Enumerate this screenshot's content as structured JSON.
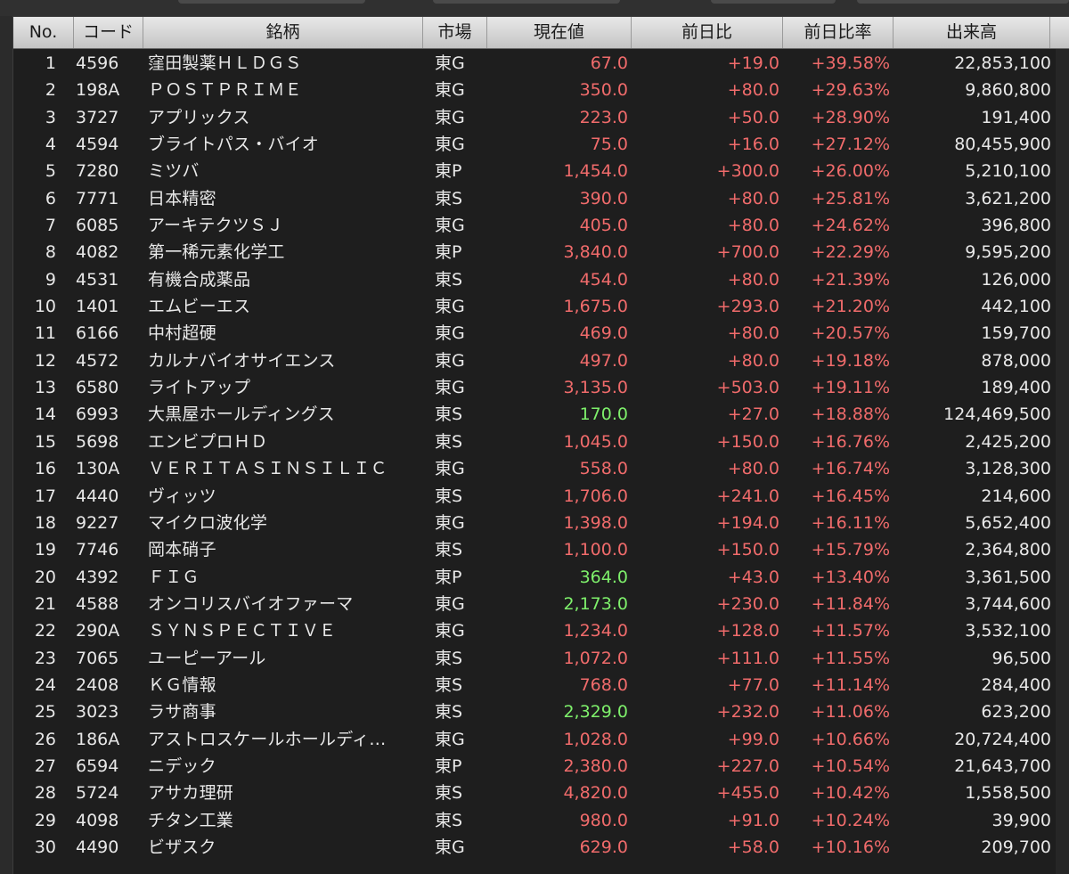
{
  "columns": {
    "no": "No.",
    "code": "コード",
    "name": "銘柄",
    "market": "市場",
    "price": "現在値",
    "change": "前日比",
    "pct": "前日比率",
    "volume": "出来高"
  },
  "colors": {
    "up": "#f06b6b",
    "highlight": "#7ef06b",
    "text": "#e8e8e8"
  },
  "rows": [
    {
      "no": "1",
      "code": "4596",
      "name": "窪田製薬ＨＬＤＧＳ",
      "market": "東G",
      "price": "67.0",
      "change": "+19.0",
      "pct": "+39.58%",
      "volume": "22,853,100",
      "highlight": false
    },
    {
      "no": "2",
      "code": "198A",
      "name": "ＰＯＳＴＰＲＩＭＥ",
      "market": "東G",
      "price": "350.0",
      "change": "+80.0",
      "pct": "+29.63%",
      "volume": "9,860,800",
      "highlight": false
    },
    {
      "no": "3",
      "code": "3727",
      "name": "アプリックス",
      "market": "東G",
      "price": "223.0",
      "change": "+50.0",
      "pct": "+28.90%",
      "volume": "191,400",
      "highlight": false
    },
    {
      "no": "4",
      "code": "4594",
      "name": "ブライトパス・バイオ",
      "market": "東G",
      "price": "75.0",
      "change": "+16.0",
      "pct": "+27.12%",
      "volume": "80,455,900",
      "highlight": false
    },
    {
      "no": "5",
      "code": "7280",
      "name": "ミツバ",
      "market": "東P",
      "price": "1,454.0",
      "change": "+300.0",
      "pct": "+26.00%",
      "volume": "5,210,100",
      "highlight": false
    },
    {
      "no": "6",
      "code": "7771",
      "name": "日本精密",
      "market": "東S",
      "price": "390.0",
      "change": "+80.0",
      "pct": "+25.81%",
      "volume": "3,621,200",
      "highlight": false
    },
    {
      "no": "7",
      "code": "6085",
      "name": "アーキテクツＳＪ",
      "market": "東G",
      "price": "405.0",
      "change": "+80.0",
      "pct": "+24.62%",
      "volume": "396,800",
      "highlight": false
    },
    {
      "no": "8",
      "code": "4082",
      "name": "第一稀元素化学工",
      "market": "東P",
      "price": "3,840.0",
      "change": "+700.0",
      "pct": "+22.29%",
      "volume": "9,595,200",
      "highlight": false
    },
    {
      "no": "9",
      "code": "4531",
      "name": "有機合成薬品",
      "market": "東S",
      "price": "454.0",
      "change": "+80.0",
      "pct": "+21.39%",
      "volume": "126,000",
      "highlight": false
    },
    {
      "no": "10",
      "code": "1401",
      "name": "エムビーエス",
      "market": "東G",
      "price": "1,675.0",
      "change": "+293.0",
      "pct": "+21.20%",
      "volume": "442,100",
      "highlight": false
    },
    {
      "no": "11",
      "code": "6166",
      "name": "中村超硬",
      "market": "東G",
      "price": "469.0",
      "change": "+80.0",
      "pct": "+20.57%",
      "volume": "159,700",
      "highlight": false
    },
    {
      "no": "12",
      "code": "4572",
      "name": "カルナバイオサイエンス",
      "market": "東G",
      "price": "497.0",
      "change": "+80.0",
      "pct": "+19.18%",
      "volume": "878,000",
      "highlight": false
    },
    {
      "no": "13",
      "code": "6580",
      "name": "ライトアップ",
      "market": "東G",
      "price": "3,135.0",
      "change": "+503.0",
      "pct": "+19.11%",
      "volume": "189,400",
      "highlight": false
    },
    {
      "no": "14",
      "code": "6993",
      "name": "大黒屋ホールディングス",
      "market": "東S",
      "price": "170.0",
      "change": "+27.0",
      "pct": "+18.88%",
      "volume": "124,469,500",
      "highlight": true
    },
    {
      "no": "15",
      "code": "5698",
      "name": "エンビプロＨＤ",
      "market": "東S",
      "price": "1,045.0",
      "change": "+150.0",
      "pct": "+16.76%",
      "volume": "2,425,200",
      "highlight": false
    },
    {
      "no": "16",
      "code": "130A",
      "name": "ＶＥＲＩＴＡＳＩＮＳＩＬＩＣ",
      "market": "東G",
      "price": "558.0",
      "change": "+80.0",
      "pct": "+16.74%",
      "volume": "3,128,300",
      "highlight": false
    },
    {
      "no": "17",
      "code": "4440",
      "name": "ヴィッツ",
      "market": "東S",
      "price": "1,706.0",
      "change": "+241.0",
      "pct": "+16.45%",
      "volume": "214,600",
      "highlight": false
    },
    {
      "no": "18",
      "code": "9227",
      "name": "マイクロ波化学",
      "market": "東G",
      "price": "1,398.0",
      "change": "+194.0",
      "pct": "+16.11%",
      "volume": "5,652,400",
      "highlight": false
    },
    {
      "no": "19",
      "code": "7746",
      "name": "岡本硝子",
      "market": "東S",
      "price": "1,100.0",
      "change": "+150.0",
      "pct": "+15.79%",
      "volume": "2,364,800",
      "highlight": false
    },
    {
      "no": "20",
      "code": "4392",
      "name": "ＦＩＧ",
      "market": "東P",
      "price": "364.0",
      "change": "+43.0",
      "pct": "+13.40%",
      "volume": "3,361,500",
      "highlight": true
    },
    {
      "no": "21",
      "code": "4588",
      "name": "オンコリスバイオファーマ",
      "market": "東G",
      "price": "2,173.0",
      "change": "+230.0",
      "pct": "+11.84%",
      "volume": "3,744,600",
      "highlight": true
    },
    {
      "no": "22",
      "code": "290A",
      "name": "ＳＹＮＳＰＥＣＴＩＶＥ",
      "market": "東G",
      "price": "1,234.0",
      "change": "+128.0",
      "pct": "+11.57%",
      "volume": "3,532,100",
      "highlight": false
    },
    {
      "no": "23",
      "code": "7065",
      "name": "ユーピーアール",
      "market": "東S",
      "price": "1,072.0",
      "change": "+111.0",
      "pct": "+11.55%",
      "volume": "96,500",
      "highlight": false
    },
    {
      "no": "24",
      "code": "2408",
      "name": "ＫＧ情報",
      "market": "東S",
      "price": "768.0",
      "change": "+77.0",
      "pct": "+11.14%",
      "volume": "284,400",
      "highlight": false
    },
    {
      "no": "25",
      "code": "3023",
      "name": "ラサ商事",
      "market": "東S",
      "price": "2,329.0",
      "change": "+232.0",
      "pct": "+11.06%",
      "volume": "623,200",
      "highlight": true
    },
    {
      "no": "26",
      "code": "186A",
      "name": "アストロスケールホールディ…",
      "market": "東G",
      "price": "1,028.0",
      "change": "+99.0",
      "pct": "+10.66%",
      "volume": "20,724,400",
      "highlight": false
    },
    {
      "no": "27",
      "code": "6594",
      "name": "ニデック",
      "market": "東P",
      "price": "2,380.0",
      "change": "+227.0",
      "pct": "+10.54%",
      "volume": "21,643,700",
      "highlight": false
    },
    {
      "no": "28",
      "code": "5724",
      "name": "アサカ理研",
      "market": "東S",
      "price": "4,820.0",
      "change": "+455.0",
      "pct": "+10.42%",
      "volume": "1,558,500",
      "highlight": false
    },
    {
      "no": "29",
      "code": "4098",
      "name": "チタン工業",
      "market": "東S",
      "price": "980.0",
      "change": "+91.0",
      "pct": "+10.24%",
      "volume": "39,900",
      "highlight": false
    },
    {
      "no": "30",
      "code": "4490",
      "name": "ビザスク",
      "market": "東G",
      "price": "629.0",
      "change": "+58.0",
      "pct": "+10.16%",
      "volume": "209,700",
      "highlight": false
    }
  ]
}
